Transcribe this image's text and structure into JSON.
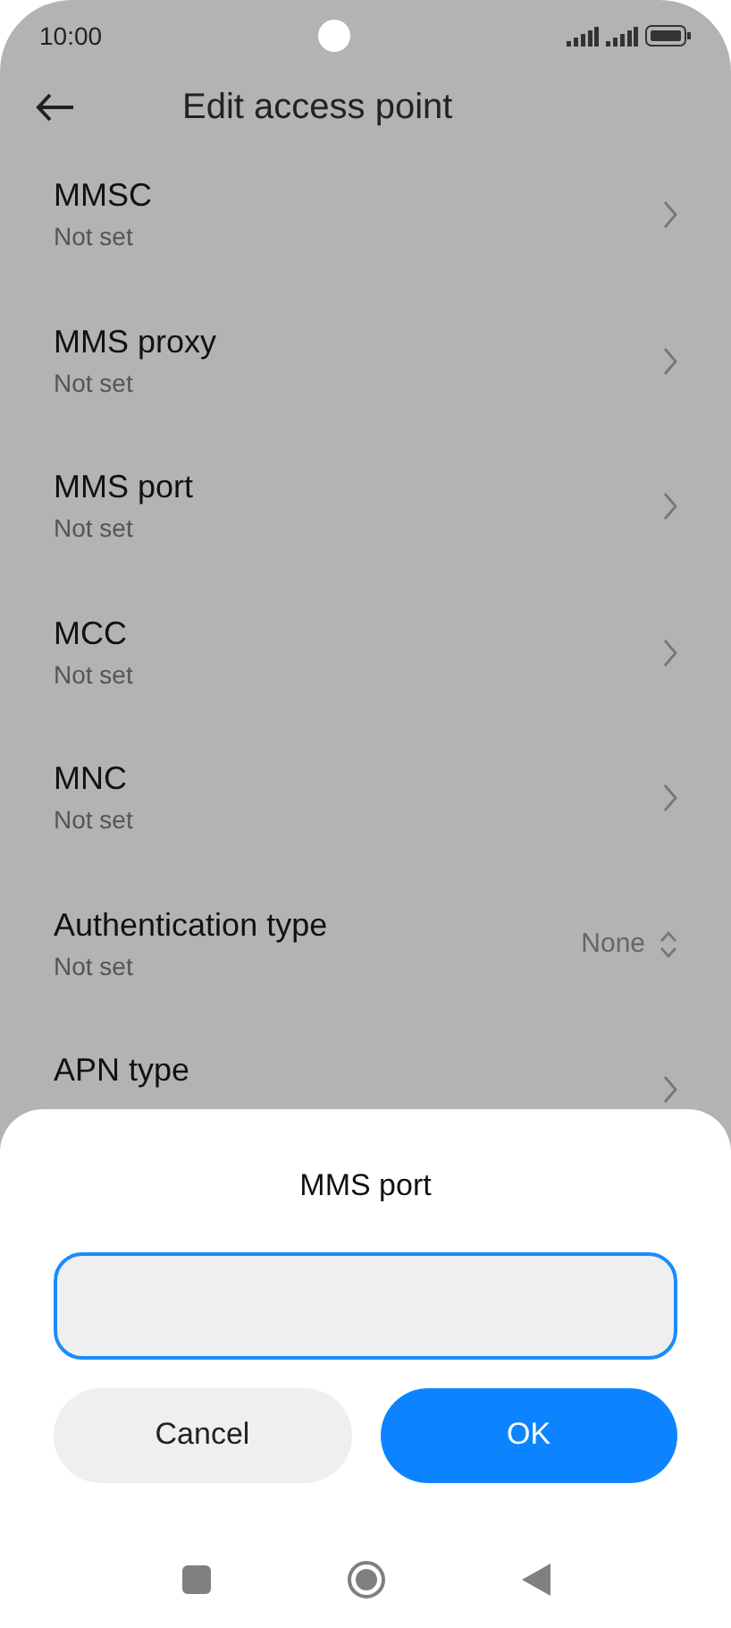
{
  "status_bar": {
    "time": "10:00"
  },
  "header": {
    "title": "Edit access point"
  },
  "settings": [
    {
      "kind": "link",
      "title": "MMSC",
      "subtitle": "Not set"
    },
    {
      "kind": "link",
      "title": "MMS proxy",
      "subtitle": "Not set"
    },
    {
      "kind": "link",
      "title": "MMS port",
      "subtitle": "Not set"
    },
    {
      "kind": "link",
      "title": "MCC",
      "subtitle": "Not set"
    },
    {
      "kind": "link",
      "title": "MNC",
      "subtitle": "Not set"
    },
    {
      "kind": "select",
      "title": "Authentication type",
      "subtitle": "Not set",
      "value": "None"
    },
    {
      "kind": "link",
      "title": "APN type"
    }
  ],
  "dialog": {
    "title": "MMS port",
    "buttons": [
      {
        "label": "Cancel",
        "kind": "secondary"
      },
      {
        "label": "OK",
        "kind": "primary"
      }
    ]
  }
}
